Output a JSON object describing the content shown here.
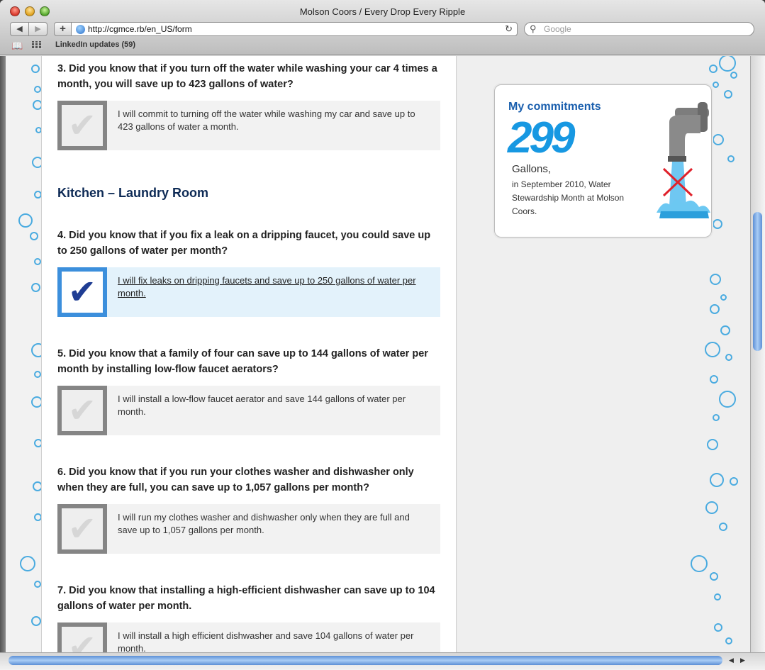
{
  "window": {
    "title": "Molson Coors / Every Drop Every Ripple"
  },
  "toolbar": {
    "back_label": "◀",
    "forward_label": "▶",
    "add_label": "+",
    "url": "http://cgmce.rb/en_US/form",
    "reload_label": "↻",
    "search_placeholder": "Google"
  },
  "bookmarks": {
    "item": "LinkedIn updates (59)"
  },
  "content": {
    "section_title": "Kitchen – Laundry Room",
    "questions": [
      {
        "text": "3. Did you know that if you turn off the water while washing your car 4 times a month, you will save up to 423 gallons of water?",
        "commitment": "I will commit to turning off the water while washing my car and save up to 423 gallons of water a month.",
        "checked": false
      },
      {
        "text": "4. Did you know that if you fix a leak on a dripping faucet, you could save up to 250 gallons of water per month?",
        "commitment": "I will fix leaks on dripping faucets and save up to 250 gallons of water per month.",
        "checked": true
      },
      {
        "text": "5. Did you know that a family of four can save up to 144 gallons of water per month by installing low-flow faucet aerators?",
        "commitment": "I will install a low-flow faucet aerator and save 144 gallons of water per month.",
        "checked": false
      },
      {
        "text": "6. Did you know that if you run your clothes washer and dishwasher only when they are full, you can save up to 1,057 gallons per month?",
        "commitment": "I will run my clothes washer and dishwasher only when they are full and save up to 1,057 gallons per month.",
        "checked": false
      },
      {
        "text": "7. Did you know that installing a high-efficient dishwasher can save up to 104 gallons of water per month.",
        "commitment": "I will install a high efficient dishwasher and save 104 gallons of water per month.",
        "checked": false
      }
    ],
    "checkmark": "✔"
  },
  "sidebar": {
    "title": "My commitments",
    "gallons": "299",
    "unit": "Gallons,",
    "description": "in September 2010, Water Stewardship Month at Molson Coors."
  },
  "colors": {
    "accent_blue": "#1798e2",
    "title_navy": "#0d2a55",
    "bubble": "#4aabe0"
  }
}
